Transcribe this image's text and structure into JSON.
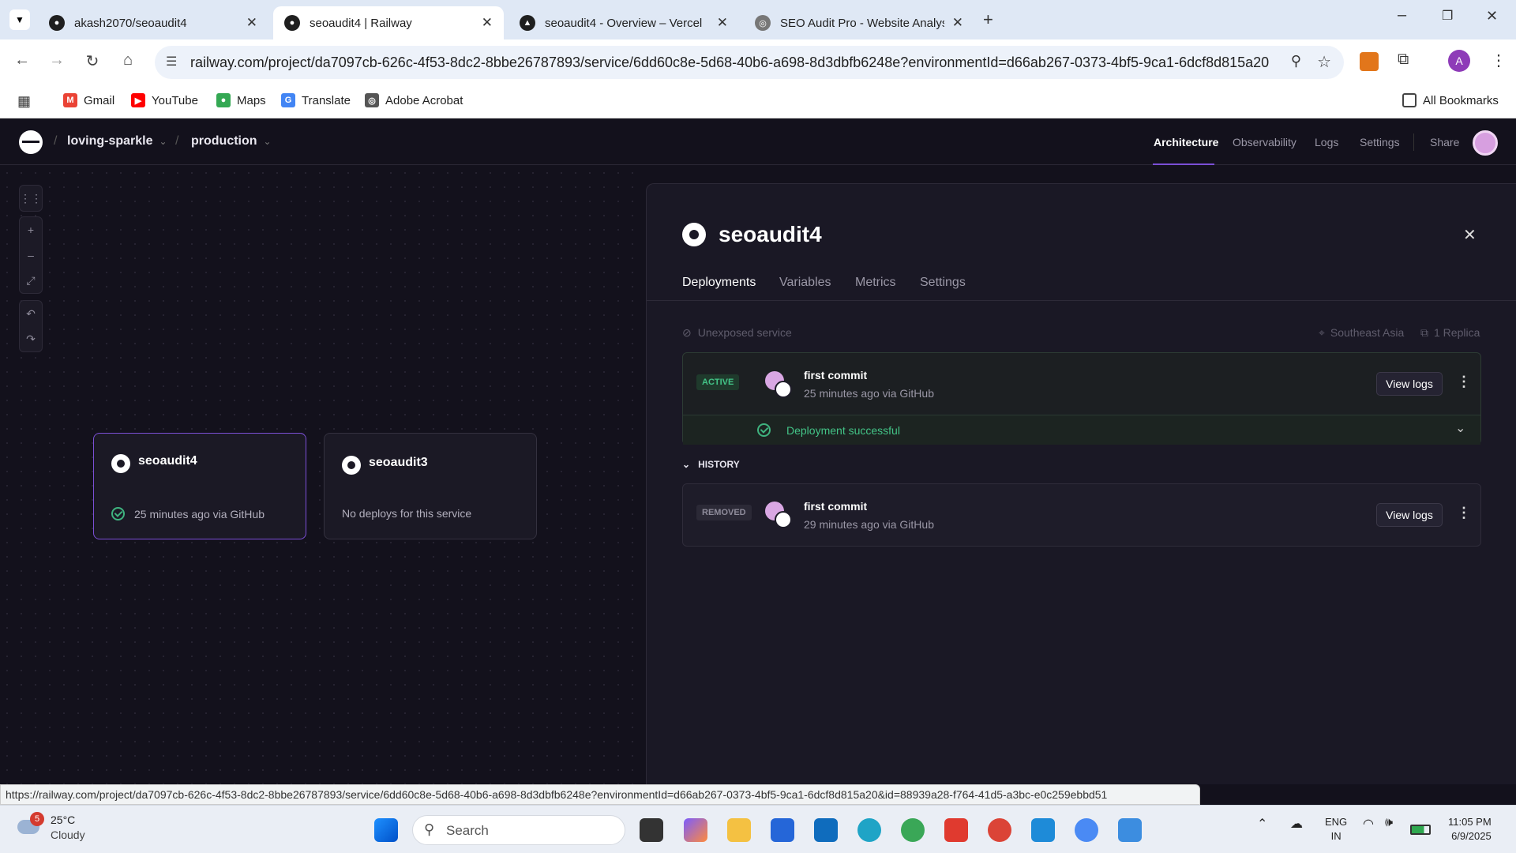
{
  "browser": {
    "tabs": [
      {
        "title": "akash2070/seoaudit4",
        "icon": "github-icon"
      },
      {
        "title": "seoaudit4 | Railway",
        "icon": "railway-icon"
      },
      {
        "title": "seoaudit4 - Overview – Vercel",
        "icon": "vercel-icon"
      },
      {
        "title": "SEO Audit Pro - Website Analys",
        "icon": "globe-icon"
      }
    ],
    "url": "railway.com/project/da7097cb-626c-4f53-8dc2-8bbe26787893/service/6dd60c8e-5d68-40b6-a698-8d3dbfb6248e?environmentId=d66ab267-0373-4bf5-9ca1-6dcf8d815a20",
    "profile_initial": "A",
    "bookmarks": [
      "Gmail",
      "YouTube",
      "Maps",
      "Translate",
      "Adobe Acrobat"
    ],
    "all_bookmarks": "All Bookmarks",
    "status_url": "https://railway.com/project/da7097cb-626c-4f53-8dc2-8bbe26787893/service/6dd60c8e-5d68-40b6-a698-8d3dbfb6248e?environmentId=d66ab267-0373-4bf5-9ca1-6dcf8d815a20&id=88939a28-f764-41d5-a3bc-e0c259ebbd51"
  },
  "app": {
    "project": "loving-sparkle",
    "environment": "production",
    "nav": [
      "Architecture",
      "Observability",
      "Logs",
      "Settings",
      "Share"
    ],
    "accent": "#7b4fd6"
  },
  "canvas": {
    "services": [
      {
        "name": "seoaudit4",
        "meta": "25 minutes ago via GitHub"
      },
      {
        "name": "seoaudit3",
        "meta": "No deploys for this service"
      }
    ]
  },
  "panel": {
    "title": "seoaudit4",
    "tabs": [
      "Deployments",
      "Variables",
      "Metrics",
      "Settings"
    ],
    "exposure": "Unexposed service",
    "region": "Southeast Asia",
    "replicas": "1 Replica",
    "active": {
      "badge": "ACTIVE",
      "commit": "first commit",
      "meta": "25 minutes ago via GitHub",
      "button": "View logs",
      "status": "Deployment successful"
    },
    "history_label": "HISTORY",
    "history": [
      {
        "badge": "REMOVED",
        "commit": "first commit",
        "meta": "29 minutes ago via GitHub",
        "button": "View logs"
      }
    ]
  },
  "taskbar": {
    "weather_temp": "25°C",
    "weather_desc": "Cloudy",
    "weather_badge": "5",
    "search": "Search",
    "lang1": "ENG",
    "lang2": "IN",
    "time": "11:05 PM",
    "date": "6/9/2025"
  }
}
